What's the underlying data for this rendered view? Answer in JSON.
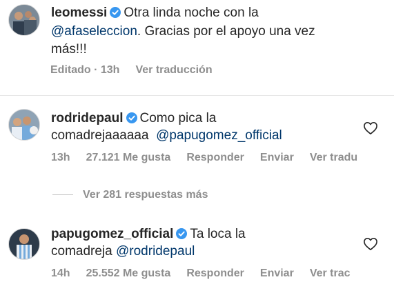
{
  "comments": [
    {
      "username": "leomessi",
      "text_before_mention": "Otra linda noche con la",
      "mention": "@afaseleccion",
      "text_after_mention": ". Gracias por el apoyo una vez",
      "text_line3": "más!!!",
      "meta": {
        "edited": "Editado · 13h",
        "translate": "Ver traducción"
      }
    },
    {
      "username": "rodridepaul",
      "text_line1": "Como pica la",
      "text_line2_prefix": "comadrejaaaaaa",
      "mention": "@papugomez_official",
      "meta": {
        "time": "13h",
        "likes": "27.121 Me gusta",
        "reply": "Responder",
        "send": "Enviar",
        "translate": "Ver tradu"
      }
    },
    {
      "username": "papugomez_official",
      "text_line1": "Ta loca la",
      "text_line2_prefix": "comadreja",
      "mention": "@rodridepaul",
      "meta": {
        "time": "14h",
        "likes": "25.552 Me gusta",
        "reply": "Responder",
        "send": "Enviar",
        "translate": "Ver trac"
      }
    }
  ],
  "view_more_replies": "Ver 281 respuestas más",
  "icons": {
    "verified": "verified-badge-icon",
    "like": "heart-outline-icon"
  },
  "colors": {
    "verified": "#3897f0",
    "mention": "#00376b",
    "muted": "#8e8e8e"
  }
}
